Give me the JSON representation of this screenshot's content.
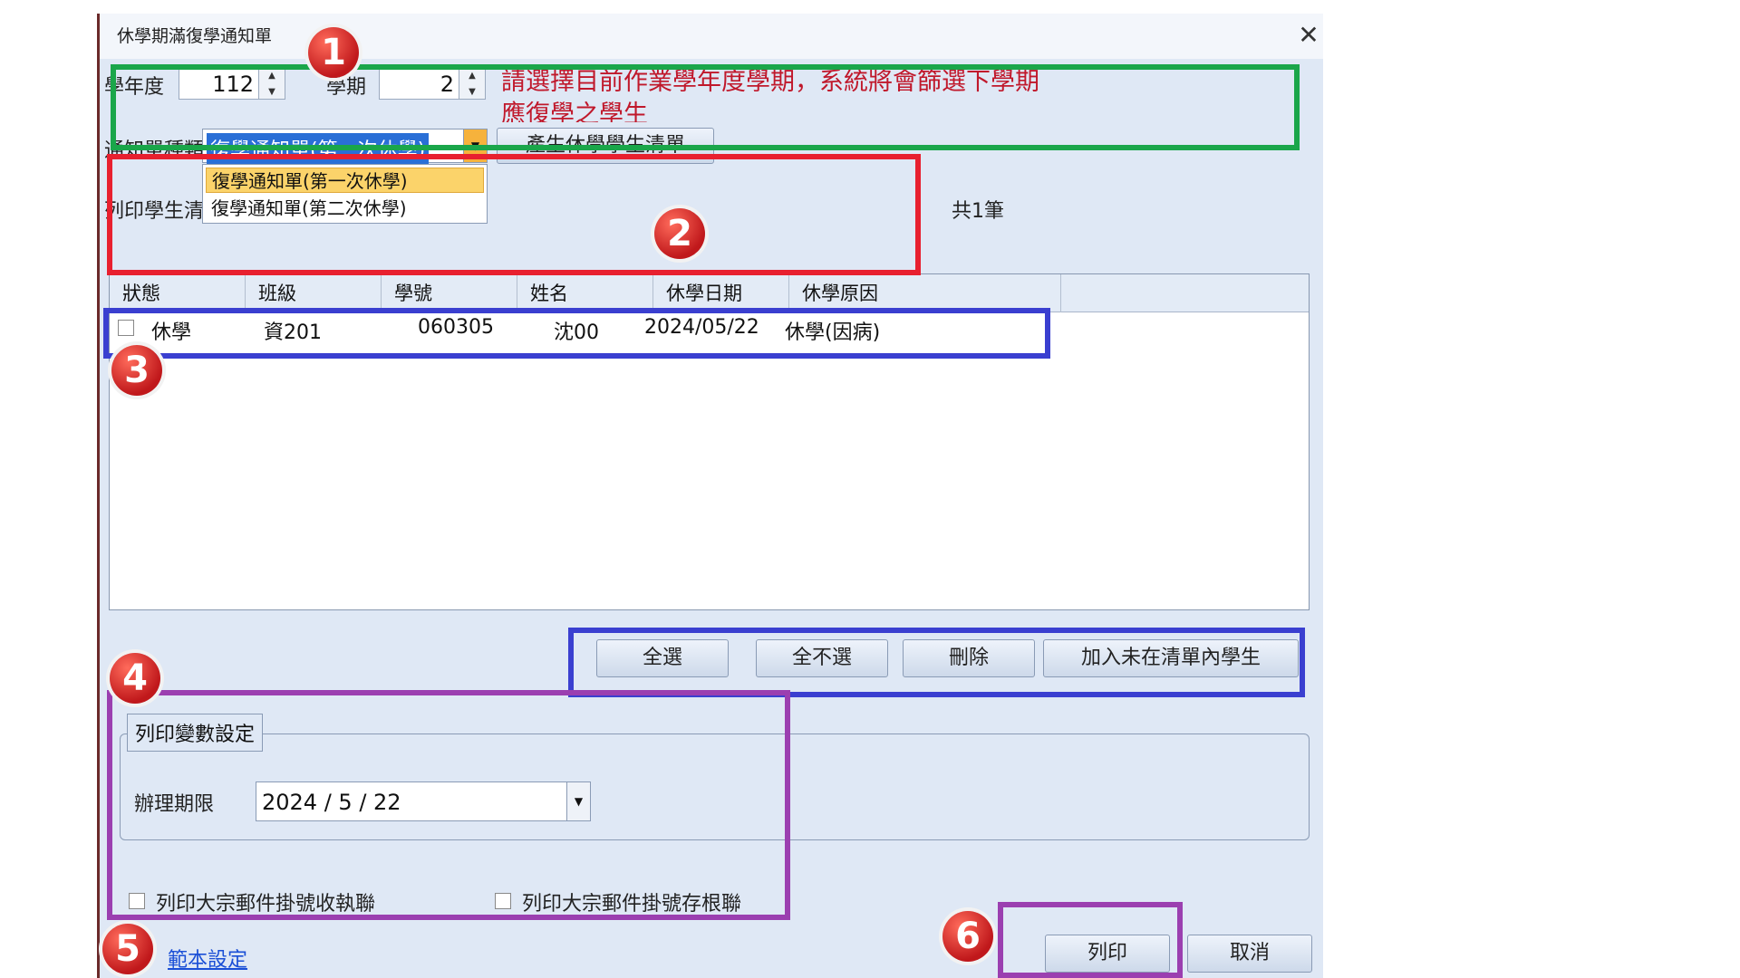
{
  "window": {
    "title": "休學期滿復學通知單"
  },
  "top": {
    "year_label": "學年度",
    "year_value": "112",
    "term_label": "學期",
    "term_value": "2",
    "hint": "請選擇目前作業學年度學期，系統將會篩選下學期應復學之學生"
  },
  "notice": {
    "type_label": "通知單種類",
    "selected": "復學通知單(第一次休學)",
    "options": [
      "復學通知單(第一次休學)",
      "復學通知單(第二次休學)"
    ],
    "generate_button": "產生休學學生清單",
    "print_list_label": "列印學生清單",
    "count": "共1筆"
  },
  "table": {
    "columns": [
      "狀態",
      "班級",
      "學號",
      "姓名",
      "休學日期",
      "休學原因"
    ],
    "rows": [
      {
        "status": "休學",
        "class": "資201",
        "id": "060305",
        "name": "沈00",
        "date": "2024/05/22",
        "reason": "休學(因病)"
      }
    ]
  },
  "actions": {
    "select_all": "全選",
    "select_none": "全不選",
    "delete": "刪除",
    "add_missing": "加入未在清單內學生"
  },
  "print_settings": {
    "legend": "列印變數設定",
    "deadline_label": "辦理期限",
    "deadline_value": "2024 / 5 / 22",
    "opt_receipt": "列印大宗郵件掛號收執聯",
    "opt_stub": "列印大宗郵件掛號存根聯"
  },
  "footer": {
    "template_link": "範本設定",
    "print": "列印",
    "cancel": "取消"
  },
  "badges": [
    "1",
    "2",
    "3",
    "4",
    "5",
    "6"
  ],
  "colors": {
    "green": "#1aa64a",
    "red": "#e8202f",
    "blue": "#3a3fd0",
    "purple": "#9b3fb0",
    "hint": "#c0182b"
  }
}
